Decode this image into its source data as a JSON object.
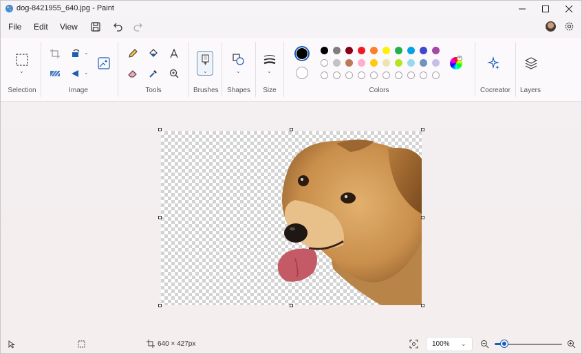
{
  "window": {
    "title": "dog-8421955_640.jpg - Paint"
  },
  "menu": {
    "file": "File",
    "edit": "Edit",
    "view": "View"
  },
  "ribbon": {
    "groups": {
      "selection": "Selection",
      "image": "Image",
      "tools": "Tools",
      "brushes": "Brushes",
      "shapes": "Shapes",
      "size": "Size",
      "colors": "Colors",
      "cocreator": "Cocreator",
      "layers": "Layers"
    },
    "palette_row1": [
      "#000000",
      "#7f7f7f",
      "#880015",
      "#ed1c24",
      "#ff7f27",
      "#fff200",
      "#22b14c",
      "#00a2e8",
      "#3f48cc",
      "#a349a4"
    ],
    "palette_row2": [
      "#ffffff",
      "#c3c3c3",
      "#b97a57",
      "#ffaec9",
      "#ffc90e",
      "#efe4b0",
      "#b5e61d",
      "#99d9ea",
      "#7092be",
      "#c8bfe7"
    ],
    "primary_color": "#000000",
    "secondary_color": "#ffffff"
  },
  "status": {
    "image_size": "640 × 427px",
    "zoom": "100%"
  }
}
